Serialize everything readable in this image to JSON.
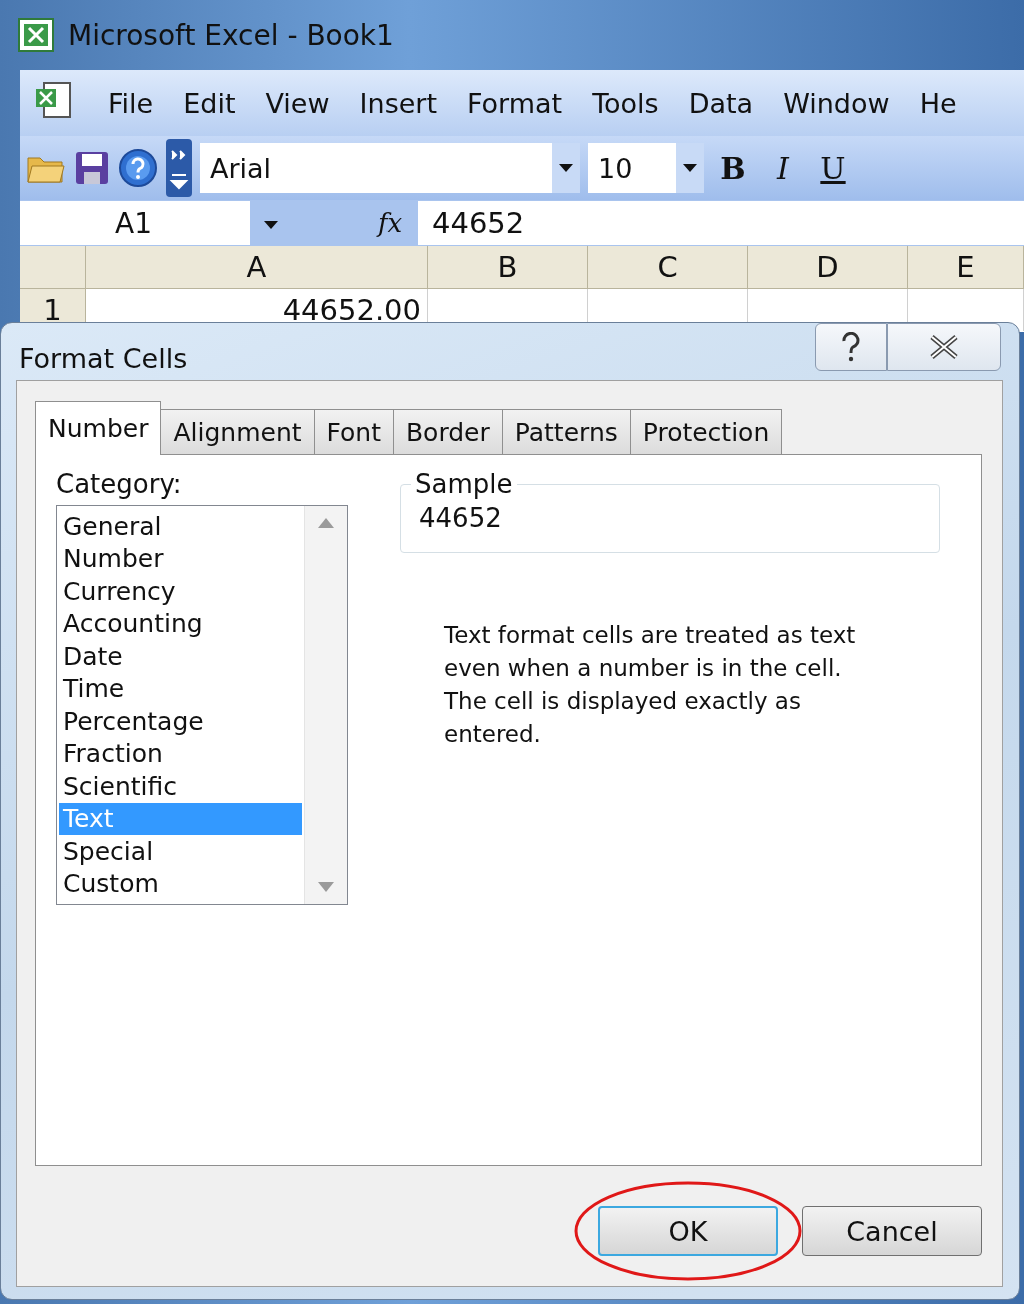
{
  "window": {
    "title": "Microsoft Excel - Book1"
  },
  "menu": [
    "File",
    "Edit",
    "View",
    "Insert",
    "Format",
    "Tools",
    "Data",
    "Window",
    "He"
  ],
  "toolbar": {
    "font": "Arial",
    "size": "10",
    "format_buttons": [
      "B",
      "I",
      "U"
    ]
  },
  "formula_bar": {
    "name_box": "A1",
    "function_label": "fx",
    "value": "44652"
  },
  "sheet": {
    "columns": [
      "A",
      "B",
      "C",
      "D",
      "E"
    ],
    "rows": [
      {
        "header": "1",
        "cells": [
          "44652.00"
        ]
      }
    ]
  },
  "dialog": {
    "title": "Format Cells",
    "tabs": [
      {
        "label": "Number",
        "selected": true
      },
      {
        "label": "Alignment",
        "selected": false
      },
      {
        "label": "Font",
        "selected": false
      },
      {
        "label": "Border",
        "selected": false
      },
      {
        "label": "Patterns",
        "selected": false
      },
      {
        "label": "Protection",
        "selected": false
      }
    ],
    "category_label": "Category:",
    "categories": [
      {
        "label": "General",
        "selected": false
      },
      {
        "label": "Number",
        "selected": false
      },
      {
        "label": "Currency",
        "selected": false
      },
      {
        "label": "Accounting",
        "selected": false
      },
      {
        "label": "Date",
        "selected": false
      },
      {
        "label": "Time",
        "selected": false
      },
      {
        "label": "Percentage",
        "selected": false
      },
      {
        "label": "Fraction",
        "selected": false
      },
      {
        "label": "Scientific",
        "selected": false
      },
      {
        "label": "Text",
        "selected": true
      },
      {
        "label": "Special",
        "selected": false
      },
      {
        "label": "Custom",
        "selected": false
      }
    ],
    "sample": {
      "legend": "Sample",
      "value": "44652"
    },
    "description": "Text format cells are treated as text even when a number is in the cell.  The cell is displayed exactly as entered.",
    "buttons": [
      {
        "label": "OK",
        "default": true,
        "circled": true
      },
      {
        "label": "Cancel",
        "default": false,
        "circled": false
      }
    ]
  }
}
